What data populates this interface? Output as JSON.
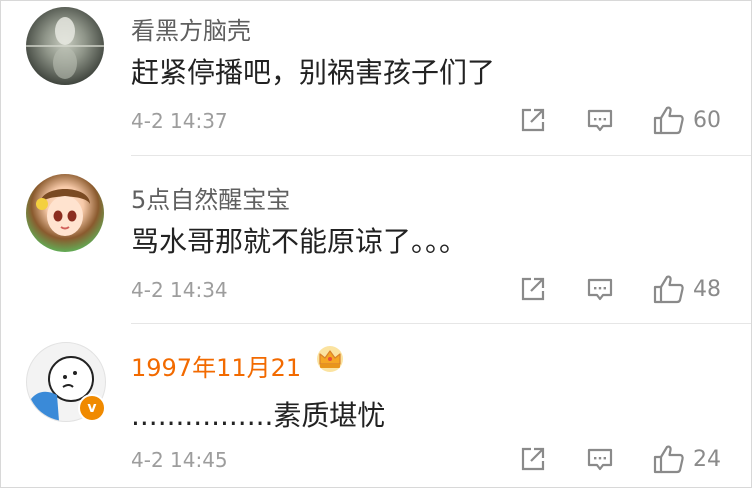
{
  "comments": [
    {
      "username": "看黑方脑壳",
      "text": "赶紧停播吧，别祸害孩子们了",
      "time": "4-2 14:37",
      "likes": "60",
      "avatar_icon": "tiger-reflection-avatar"
    },
    {
      "username": "5点自然醒宝宝",
      "text": "骂水哥那就不能原谅了。。。",
      "time": "4-2 14:34",
      "likes": "48",
      "avatar_icon": "doll-girl-avatar"
    },
    {
      "username": "1997年11月21",
      "text": "................素质堪忧",
      "time": "4-2 14:45",
      "likes": "24",
      "avatar_icon": "cartoon-face-avatar",
      "username_color": "#f26a00",
      "badge_letter": "v"
    }
  ],
  "icons": {
    "share": "share-icon",
    "comment": "comment-icon",
    "like": "thumbs-up-icon",
    "vip": "crown-icon"
  }
}
